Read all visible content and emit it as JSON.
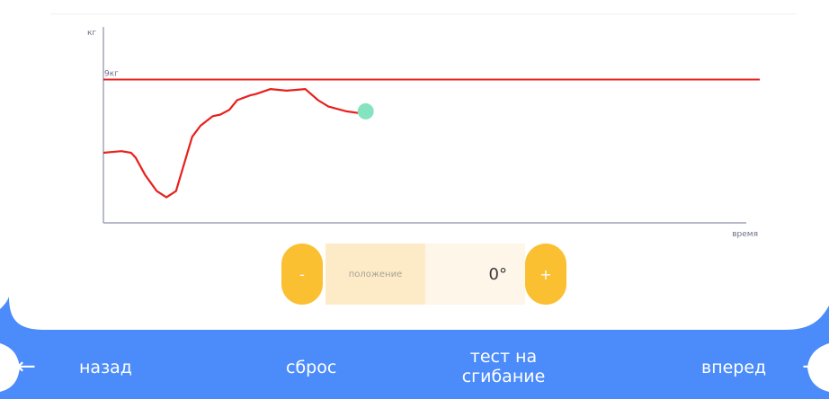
{
  "chart_data": {
    "type": "line",
    "ylabel": "кг",
    "xlabel": "время",
    "threshold": {
      "value": 9,
      "label": "9кг",
      "color": "#e8201c"
    },
    "ylim": [
      0,
      12.3
    ],
    "xlim": [
      0,
      100
    ],
    "series": [
      {
        "color": "#e8201c",
        "x": [
          0,
          2.8,
          4.3,
          5,
          6.5,
          8.3,
          9.8,
          11.3,
          13.8,
          15.1,
          17,
          18.2,
          19.6,
          20.8,
          22.8,
          23.8,
          26,
          28.5,
          31.4,
          33.4,
          35,
          37.8,
          39.6,
          40.8
        ],
        "y": [
          4.4,
          4.5,
          4.4,
          4.1,
          3.0,
          2.0,
          1.6,
          2.0,
          5.4,
          6.1,
          6.7,
          6.8,
          7.1,
          7.7,
          8.0,
          8.1,
          8.4,
          8.3,
          8.4,
          7.7,
          7.3,
          7.0,
          6.9,
          7.0
        ]
      }
    ],
    "current_point": {
      "x": 40.8,
      "y": 7.0,
      "color": "#86e3c0"
    }
  },
  "control": {
    "minus_label": "-",
    "position_label": "положение",
    "position_value": "0°",
    "plus_label": "+"
  },
  "nav": {
    "back_label": "назад",
    "reset_label": "сброс",
    "test_label_line1": "тест на",
    "test_label_line2": "сгибание",
    "forward_label": "вперед",
    "left_arrow": "←",
    "right_arrow": "→"
  },
  "colors": {
    "accent_blue": "#4c8cfa",
    "button_yellow": "#fbbf32"
  }
}
